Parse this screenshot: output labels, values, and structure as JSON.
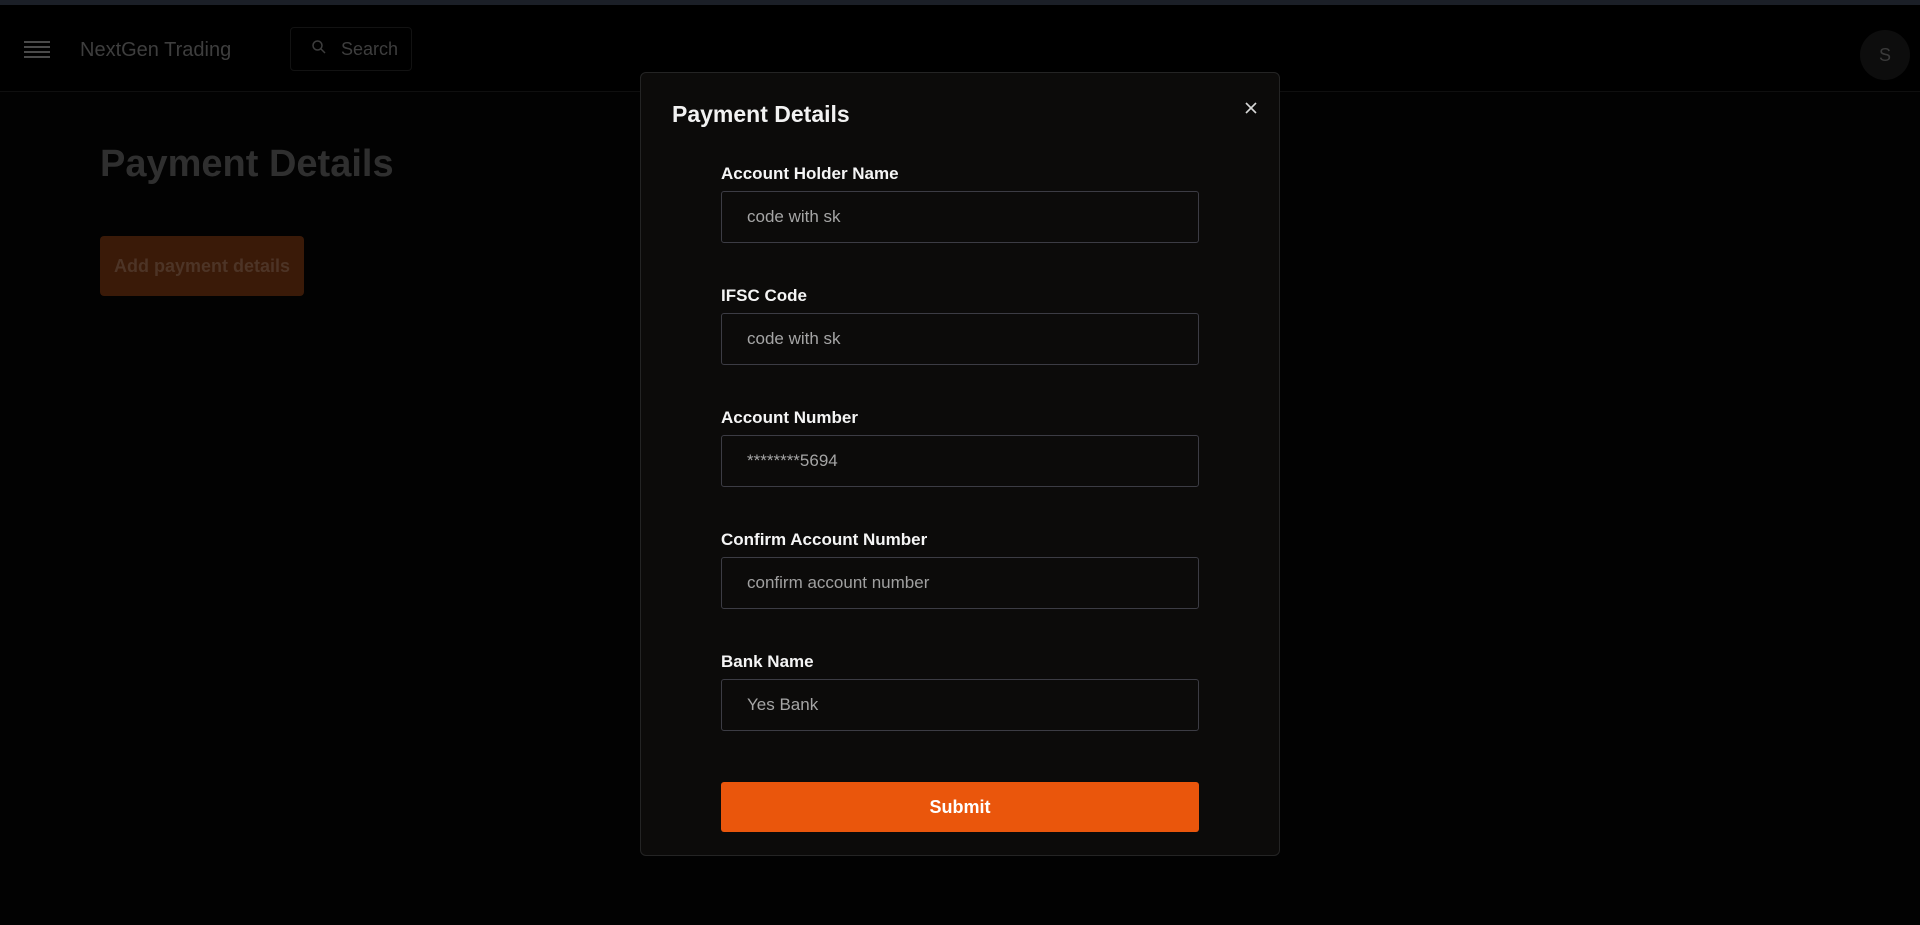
{
  "app": {
    "brand": "NextGen Trading",
    "search_label": "Search",
    "avatar_initial": "S"
  },
  "page": {
    "title": "Payment Details",
    "add_button_label": "Add payment details"
  },
  "modal": {
    "title": "Payment Details",
    "fields": [
      {
        "label": "Account Holder Name",
        "value": "code with sk",
        "placeholder": ""
      },
      {
        "label": "IFSC Code",
        "value": "code with sk",
        "placeholder": ""
      },
      {
        "label": "Account Number",
        "value": "********5694",
        "placeholder": ""
      },
      {
        "label": "Confirm Account Number",
        "value": "",
        "placeholder": "confirm account number"
      },
      {
        "label": "Bank Name",
        "value": "Yes Bank",
        "placeholder": ""
      }
    ],
    "submit_label": "Submit"
  },
  "icons": {
    "menu": "menu-icon",
    "search": "search-icon",
    "close": "close-icon"
  },
  "colors": {
    "accent": "#ea560c",
    "background": "#020202",
    "modal_background": "#0c0b0a"
  }
}
